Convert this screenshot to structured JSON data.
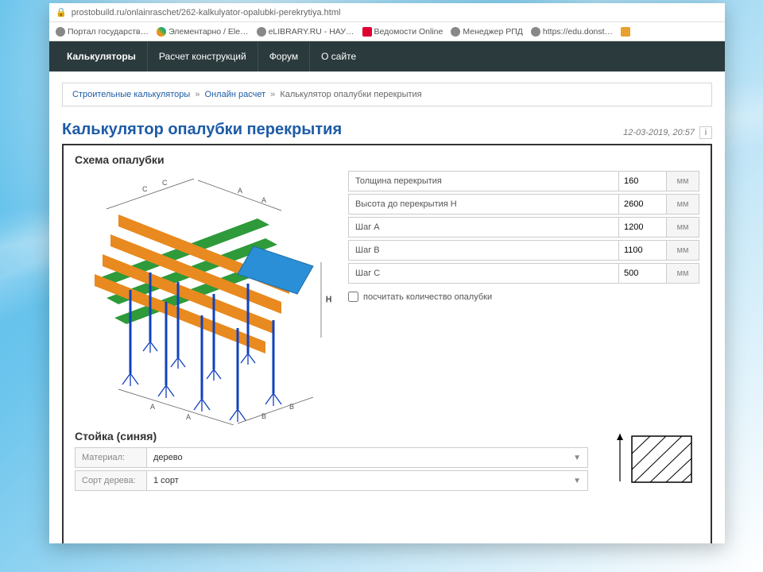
{
  "url": "prostobuild.ru/onlainraschet/262-kalkulyator-opalubki-perekrytiya.html",
  "bookmarks": [
    {
      "label": "Портал государств…",
      "iconClass": "globe"
    },
    {
      "label": "Элементарно / Ele…",
      "iconClass": "colorful"
    },
    {
      "label": "eLIBRARY.RU - НАУ…",
      "iconClass": "globe"
    },
    {
      "label": "Ведомости Online",
      "iconClass": "angular"
    },
    {
      "label": "Менеджер РПД",
      "iconClass": "globe"
    },
    {
      "label": "https://edu.donst…",
      "iconClass": "globe"
    },
    {
      "label": "",
      "iconClass": "last"
    }
  ],
  "nav": {
    "items": [
      "Калькуляторы",
      "Расчет конструкций",
      "Форум",
      "О сайте"
    ]
  },
  "breadcrumb": {
    "a": "Строительные калькуляторы",
    "b": "Онлайн расчет",
    "current": "Калькулятор опалубки перекрытия",
    "sep": "»"
  },
  "page_title": "Калькулятор опалубки перекрытия",
  "timestamp": "12-03-2019, 20:57",
  "sections": {
    "schema_title": "Схема опалубки",
    "stoika_title": "Стойка (синяя)"
  },
  "params": [
    {
      "label": "Толщина перекрытия",
      "value": "160",
      "unit": "мм"
    },
    {
      "label": "Высота до перекрытия H",
      "value": "2600",
      "unit": "мм"
    },
    {
      "label": "Шаг A",
      "value": "1200",
      "unit": "мм"
    },
    {
      "label": "Шаг B",
      "value": "1100",
      "unit": "мм"
    },
    {
      "label": "Шаг C",
      "value": "500",
      "unit": "мм"
    }
  ],
  "checkbox_label": "посчитать количество опалубки",
  "selects": {
    "material": {
      "label": "Материал:",
      "value": "дерево"
    },
    "grade": {
      "label": "Сорт дерева:",
      "value": "1 сорт"
    }
  }
}
